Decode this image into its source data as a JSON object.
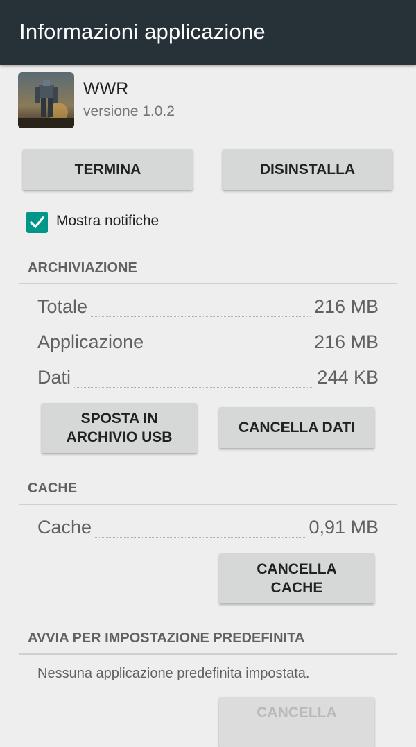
{
  "actionbar": {
    "title": "Informazioni applicazione"
  },
  "app": {
    "name": "WWR",
    "version": "versione 1.0.2",
    "icon": "app-icon-robot"
  },
  "buttons": {
    "terminate": "TERMINA",
    "uninstall": "DISINSTALLA"
  },
  "notifications": {
    "label": "Mostra notifiche",
    "checked": true,
    "accent": "#009688"
  },
  "storage": {
    "header": "ARCHIVIAZIONE",
    "rows": [
      {
        "label": "Totale",
        "value": "216 MB"
      },
      {
        "label": "Applicazione",
        "value": "216 MB"
      },
      {
        "label": "Dati",
        "value": "244 KB"
      }
    ],
    "move_button": "SPOSTA IN\nARCHIVIO USB",
    "clear_data_button": "CANCELLA DATI"
  },
  "cache": {
    "header": "CACHE",
    "row": {
      "label": "Cache",
      "value": "0,91 MB"
    },
    "clear_button": "CANCELLA\nCACHE"
  },
  "defaults": {
    "header": "AVVIA PER IMPOSTAZIONE PREDEFINITA",
    "text": "Nessuna applicazione predefinita impostata.",
    "clear_button": "CANCELLA"
  },
  "colors": {
    "actionbar": "#263238",
    "background": "#eeeeee",
    "button": "#d6d7d7"
  }
}
